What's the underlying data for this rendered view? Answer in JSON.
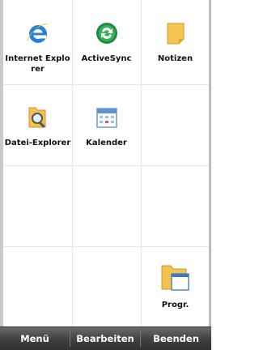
{
  "grid": {
    "cells": [
      {
        "label": "Internet Explorer",
        "icon": "internet-explorer-icon"
      },
      {
        "label": "ActiveSync",
        "icon": "activesync-icon"
      },
      {
        "label": "Notizen",
        "icon": "notes-icon"
      },
      {
        "label": "Datei-Explorer",
        "icon": "file-explorer-icon"
      },
      {
        "label": "Kalender",
        "icon": "calendar-icon"
      },
      {
        "label": "Progr.",
        "icon": "programs-folder-icon"
      }
    ]
  },
  "menubar": {
    "left": "Menü",
    "center": "Bearbeiten",
    "right": "Beenden"
  },
  "colors": {
    "menubar_top": "#6b6b6b",
    "menubar_bottom": "#333333",
    "ie_blue": "#2a7fd6",
    "activesync_green": "#2ea44f",
    "folder_yellow": "#f2c14e"
  }
}
